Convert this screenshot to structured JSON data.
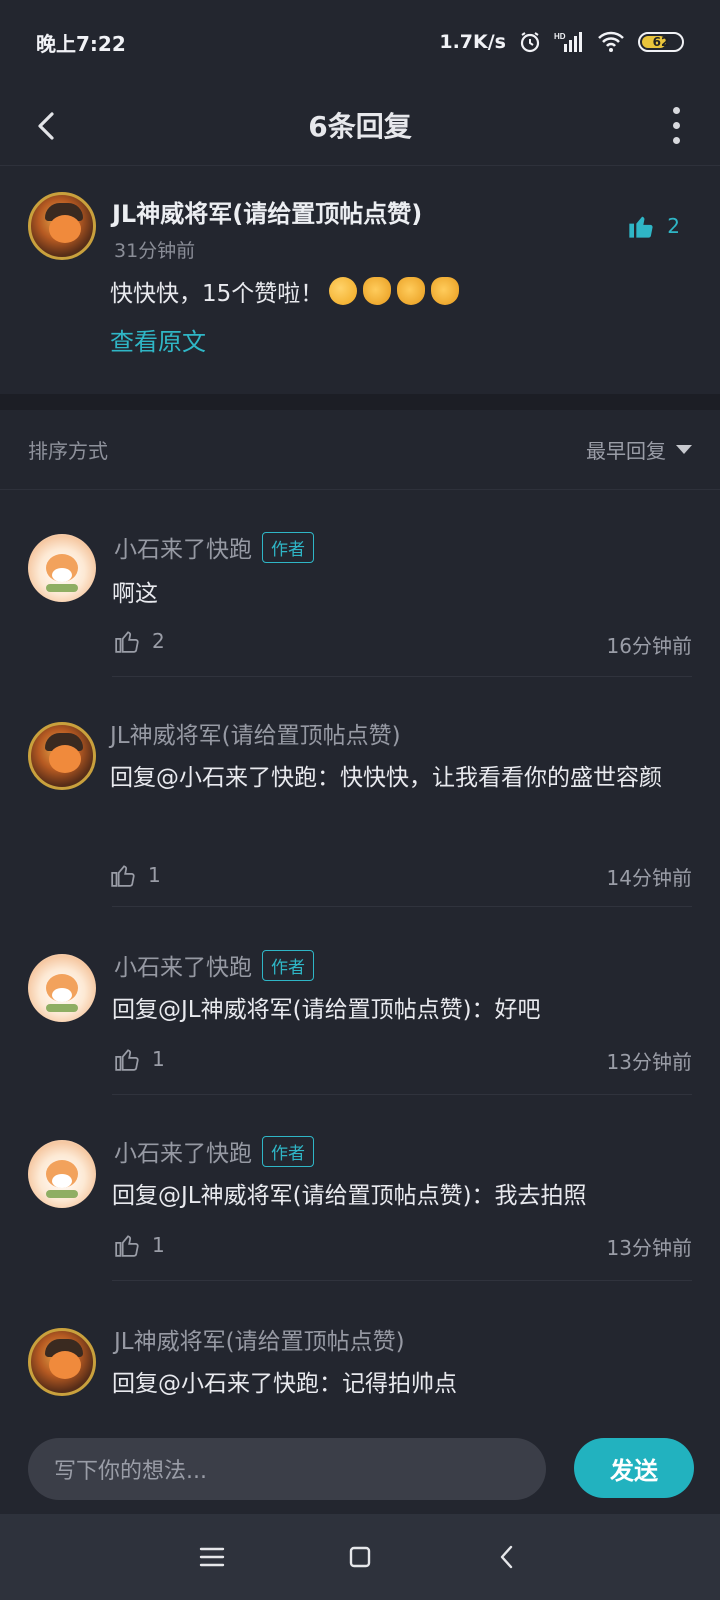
{
  "status_bar": {
    "time": "晚上7:22",
    "speed": "1.7K/s",
    "battery": "62",
    "battery_level": 0.62
  },
  "nav": {
    "title": "6条回复"
  },
  "original_post": {
    "author": "JL神威将军(请给置顶帖点赞)",
    "time": "31分钟前",
    "text": "快快快，15个赞啦！",
    "view_original": "查看原文",
    "likes": "2"
  },
  "sort": {
    "label": "排序方式",
    "value": "最早回复"
  },
  "replies": [
    {
      "author": "小石来了快跑",
      "is_author": true,
      "tag": "作者",
      "text": "啊这",
      "likes": "2",
      "time": "16分钟前"
    },
    {
      "author": "JL神威将军(请给置顶帖点赞)",
      "is_author": false,
      "text": "回复@小石来了快跑：快快快，让我看看你的盛世容颜",
      "likes": "1",
      "time": "14分钟前"
    },
    {
      "author": "小石来了快跑",
      "is_author": true,
      "tag": "作者",
      "text": "回复@JL神威将军(请给置顶帖点赞)：好吧",
      "likes": "1",
      "time": "13分钟前"
    },
    {
      "author": "小石来了快跑",
      "is_author": true,
      "tag": "作者",
      "text": "回复@JL神威将军(请给置顶帖点赞)：我去拍照",
      "likes": "1",
      "time": "13分钟前"
    },
    {
      "author": "JL神威将军(请给置顶帖点赞)",
      "is_author": false,
      "text": "回复@小石来了快跑：记得拍帅点"
    }
  ],
  "composer": {
    "placeholder": "写下你的想法...",
    "send_label": "发送"
  },
  "colors": {
    "accent": "#2fb6c6",
    "background": "#23262f",
    "send_button": "#22b2bf"
  }
}
